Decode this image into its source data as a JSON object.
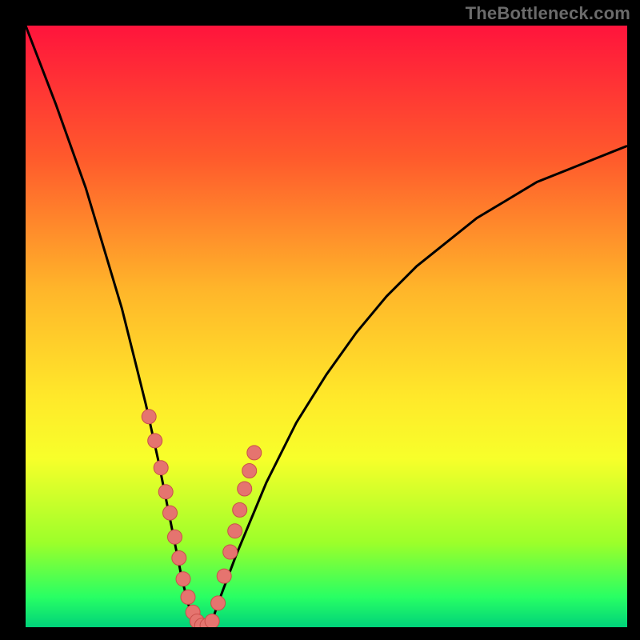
{
  "watermark": "TheBottleneck.com",
  "colors": {
    "frame": "#000000",
    "curve": "#000000",
    "marker_fill": "#e5746f",
    "marker_stroke": "#c94f4a",
    "gradient": [
      "#ff143c",
      "#ff5a2c",
      "#ffb62a",
      "#ffe92a",
      "#f7ff2a",
      "#9cff2a",
      "#28ff64",
      "#00d27a"
    ]
  },
  "chart_data": {
    "type": "line",
    "title": "",
    "xlabel": "",
    "ylabel": "",
    "xlim": [
      0,
      100
    ],
    "ylim": [
      0,
      100
    ],
    "series": [
      {
        "name": "bottleneck-curve",
        "x": [
          0,
          5,
          10,
          13,
          16,
          18,
          20,
          22,
          24,
          26,
          27,
          28,
          29,
          30,
          31,
          32,
          35,
          40,
          45,
          50,
          55,
          60,
          65,
          70,
          75,
          80,
          85,
          90,
          95,
          100
        ],
        "values": [
          100,
          87,
          73,
          63,
          53,
          45,
          37,
          28,
          18,
          8,
          4,
          1,
          0,
          0,
          1,
          4,
          12,
          24,
          34,
          42,
          49,
          55,
          60,
          64,
          68,
          71,
          74,
          76,
          78,
          80
        ]
      }
    ],
    "markers": {
      "name": "highlighted-points",
      "x": [
        20.5,
        21.5,
        22.5,
        23.3,
        24.0,
        24.8,
        25.5,
        26.2,
        27.0,
        27.8,
        28.5,
        29.3,
        30.2,
        31.0,
        32.0,
        33.0,
        34.0,
        34.8,
        35.6,
        36.4,
        37.2,
        38.0
      ],
      "values": [
        35.0,
        31.0,
        26.5,
        22.5,
        19.0,
        15.0,
        11.5,
        8.0,
        5.0,
        2.5,
        1.0,
        0.3,
        0.3,
        1.0,
        4.0,
        8.5,
        12.5,
        16.0,
        19.5,
        23.0,
        26.0,
        29.0
      ]
    }
  }
}
